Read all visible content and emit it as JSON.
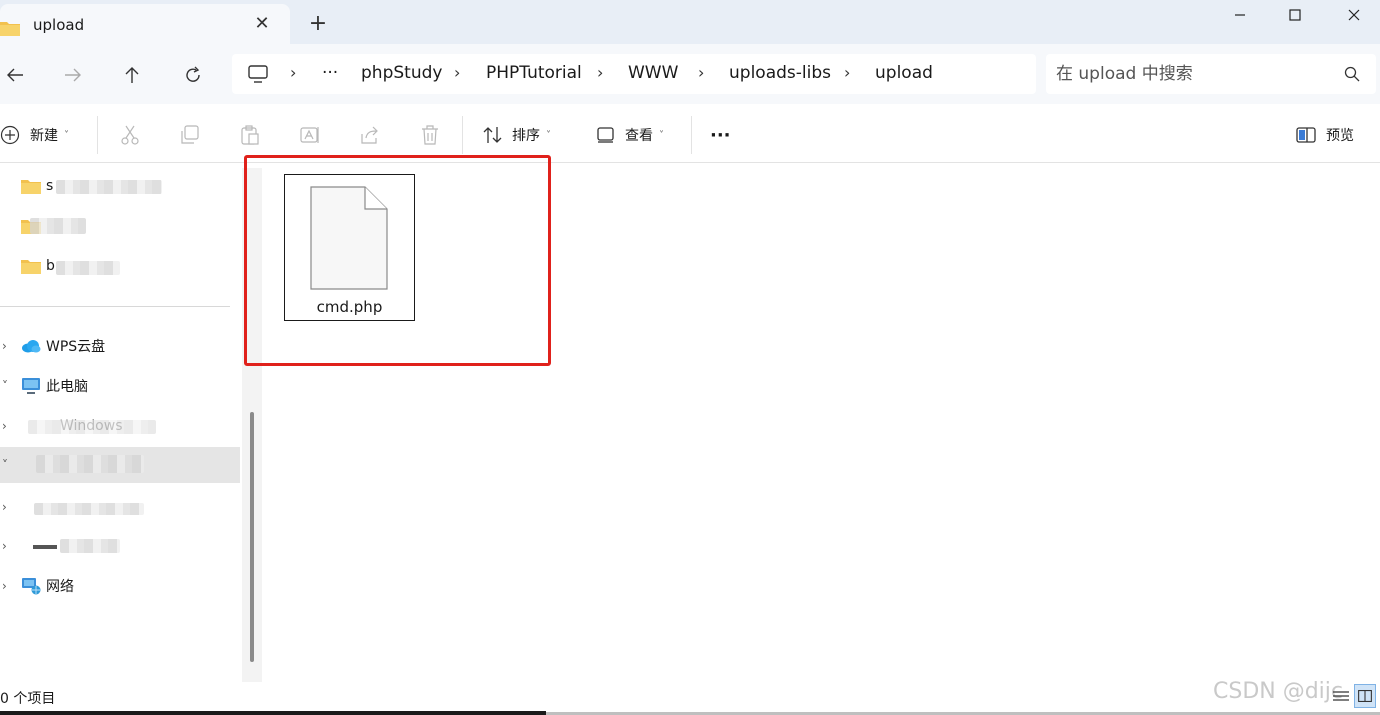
{
  "tab": {
    "title": "upload",
    "close_symbol": "✕",
    "new_symbol": "+"
  },
  "window_controls": {
    "minimize": "–",
    "maximize": "☐",
    "close": "✕"
  },
  "breadcrumb": {
    "more": "···",
    "items": [
      "phpStudy",
      "PHPTutorial",
      "WWW",
      "uploads-libs",
      "upload"
    ],
    "separator": "›"
  },
  "search": {
    "placeholder": "在 upload 中搜索",
    "value": ""
  },
  "toolbar": {
    "new_label": "新建",
    "sort_label": "排序",
    "view_label": "查看",
    "more_label": "···",
    "preview_label": "预览"
  },
  "sidebar": {
    "items": [
      {
        "label": "s",
        "icon": "folder-icon",
        "blurred": true
      },
      {
        "label": "",
        "icon": "folder-icon",
        "blurred": true
      },
      {
        "label": "b",
        "icon": "folder-icon",
        "blurred": true
      },
      {
        "label": "WPS云盘",
        "icon": "cloud-icon",
        "blurred": false
      },
      {
        "label": "此电脑",
        "icon": "computer-icon",
        "blurred": false
      },
      {
        "label": "Windows",
        "icon": "drive-icon",
        "blurred": true
      },
      {
        "label": "",
        "icon": "drive-icon",
        "blurred": true
      },
      {
        "label": "",
        "icon": "drive-icon",
        "blurred": true
      },
      {
        "label": "",
        "icon": "drive-icon",
        "blurred": true
      },
      {
        "label": "网络",
        "icon": "network-icon",
        "blurred": false
      }
    ]
  },
  "files": [
    {
      "name": "cmd.php",
      "icon": "document-icon"
    }
  ],
  "status": {
    "count": "0 个项目"
  },
  "watermark": "CSDN @dijc",
  "colors": {
    "highlight": "#e0211b",
    "titlebar": "#e8eef6",
    "folder": "#f2c14e"
  }
}
